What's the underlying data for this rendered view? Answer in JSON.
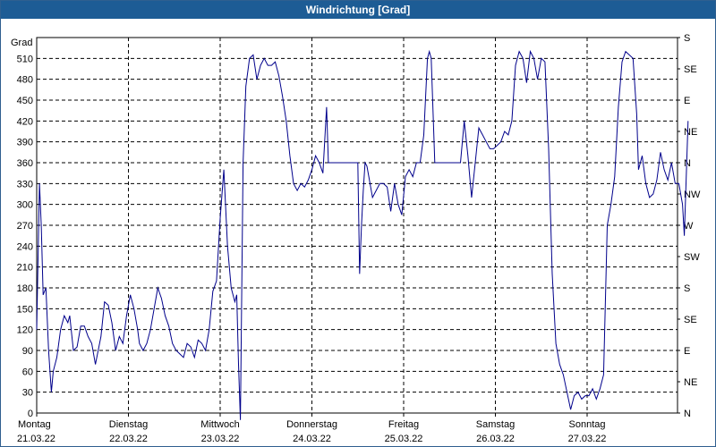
{
  "window": {
    "title": "Windrichtung [Grad]"
  },
  "chart_data": {
    "type": "line",
    "title": "Windrichtung [Grad]",
    "ylabel": "Grad",
    "ylim": [
      0,
      540
    ],
    "y_ticks": [
      0,
      30,
      60,
      90,
      120,
      150,
      180,
      210,
      240,
      270,
      300,
      330,
      360,
      390,
      420,
      450,
      480,
      510
    ],
    "right_ticks": [
      {
        "value": 0,
        "label": "N"
      },
      {
        "value": 45,
        "label": "NE"
      },
      {
        "value": 90,
        "label": "E"
      },
      {
        "value": 135,
        "label": "SE"
      },
      {
        "value": 180,
        "label": "S"
      },
      {
        "value": 225,
        "label": "SW"
      },
      {
        "value": 270,
        "label": "W"
      },
      {
        "value": 315,
        "label": "NW"
      },
      {
        "value": 360,
        "label": "N"
      },
      {
        "value": 405,
        "label": "NE"
      },
      {
        "value": 450,
        "label": "E"
      },
      {
        "value": 495,
        "label": "SE"
      },
      {
        "value": 540,
        "label": "S"
      }
    ],
    "xlim": [
      0,
      7
    ],
    "x_ticks": [
      {
        "day": "Montag",
        "date": "21.03.22"
      },
      {
        "day": "Dienstag",
        "date": "22.03.22"
      },
      {
        "day": "Mittwoch",
        "date": "23.03.22"
      },
      {
        "day": "Donnerstag",
        "date": "24.03.22"
      },
      {
        "day": "Freitag",
        "date": "25.03.22"
      },
      {
        "day": "Samstag",
        "date": "26.03.22"
      },
      {
        "day": "Sonntag",
        "date": "27.03.22"
      }
    ],
    "grid": true,
    "series": [
      {
        "color": "#00008b",
        "points": [
          [
            0.0,
            120
          ],
          [
            0.03,
            330
          ],
          [
            0.05,
            270
          ],
          [
            0.07,
            170
          ],
          [
            0.1,
            180
          ],
          [
            0.13,
            90
          ],
          [
            0.16,
            30
          ],
          [
            0.18,
            60
          ],
          [
            0.22,
            80
          ],
          [
            0.26,
            120
          ],
          [
            0.3,
            140
          ],
          [
            0.34,
            130
          ],
          [
            0.36,
            140
          ],
          [
            0.4,
            90
          ],
          [
            0.44,
            95
          ],
          [
            0.48,
            125
          ],
          [
            0.52,
            125
          ],
          [
            0.56,
            110
          ],
          [
            0.6,
            100
          ],
          [
            0.64,
            70
          ],
          [
            0.7,
            110
          ],
          [
            0.74,
            160
          ],
          [
            0.78,
            155
          ],
          [
            0.82,
            130
          ],
          [
            0.86,
            90
          ],
          [
            0.9,
            110
          ],
          [
            0.94,
            100
          ],
          [
            0.98,
            140
          ],
          [
            1.02,
            170
          ],
          [
            1.06,
            150
          ],
          [
            1.1,
            120
          ],
          [
            1.12,
            100
          ],
          [
            1.16,
            90
          ],
          [
            1.2,
            100
          ],
          [
            1.24,
            120
          ],
          [
            1.28,
            150
          ],
          [
            1.32,
            180
          ],
          [
            1.36,
            165
          ],
          [
            1.4,
            140
          ],
          [
            1.44,
            125
          ],
          [
            1.48,
            100
          ],
          [
            1.52,
            90
          ],
          [
            1.56,
            85
          ],
          [
            1.6,
            80
          ],
          [
            1.64,
            100
          ],
          [
            1.68,
            95
          ],
          [
            1.72,
            80
          ],
          [
            1.76,
            105
          ],
          [
            1.8,
            100
          ],
          [
            1.84,
            90
          ],
          [
            1.88,
            120
          ],
          [
            1.92,
            175
          ],
          [
            1.96,
            190
          ],
          [
            2.0,
            280
          ],
          [
            2.04,
            350
          ],
          [
            2.08,
            240
          ],
          [
            2.12,
            180
          ],
          [
            2.16,
            160
          ],
          [
            2.18,
            170
          ],
          [
            2.2,
            70
          ],
          [
            2.22,
            -10
          ],
          [
            2.25,
            360
          ],
          [
            2.28,
            470
          ],
          [
            2.32,
            510
          ],
          [
            2.36,
            515
          ],
          [
            2.4,
            480
          ],
          [
            2.44,
            500
          ],
          [
            2.48,
            510
          ],
          [
            2.52,
            500
          ],
          [
            2.56,
            500
          ],
          [
            2.6,
            505
          ],
          [
            2.64,
            485
          ],
          [
            2.68,
            455
          ],
          [
            2.72,
            420
          ],
          [
            2.76,
            370
          ],
          [
            2.8,
            330
          ],
          [
            2.84,
            320
          ],
          [
            2.88,
            330
          ],
          [
            2.92,
            325
          ],
          [
            2.96,
            335
          ],
          [
            3.0,
            350
          ],
          [
            3.04,
            370
          ],
          [
            3.08,
            360
          ],
          [
            3.12,
            345
          ],
          [
            3.16,
            440
          ],
          [
            3.18,
            360
          ],
          [
            3.22,
            360
          ],
          [
            3.26,
            360
          ],
          [
            3.3,
            360
          ],
          [
            3.34,
            360
          ],
          [
            3.38,
            360
          ],
          [
            3.42,
            360
          ],
          [
            3.46,
            360
          ],
          [
            3.5,
            360
          ],
          [
            3.52,
            200
          ],
          [
            3.54,
            270
          ],
          [
            3.56,
            320
          ],
          [
            3.58,
            360
          ],
          [
            3.6,
            355
          ],
          [
            3.62,
            340
          ],
          [
            3.66,
            310
          ],
          [
            3.7,
            320
          ],
          [
            3.74,
            330
          ],
          [
            3.78,
            330
          ],
          [
            3.82,
            325
          ],
          [
            3.86,
            290
          ],
          [
            3.9,
            330
          ],
          [
            3.94,
            300
          ],
          [
            3.98,
            285
          ],
          [
            4.02,
            340
          ],
          [
            4.06,
            350
          ],
          [
            4.1,
            340
          ],
          [
            4.14,
            360
          ],
          [
            4.18,
            360
          ],
          [
            4.22,
            400
          ],
          [
            4.26,
            510
          ],
          [
            4.28,
            520
          ],
          [
            4.3,
            510
          ],
          [
            4.34,
            360
          ],
          [
            4.38,
            360
          ],
          [
            4.42,
            360
          ],
          [
            4.46,
            360
          ],
          [
            4.5,
            360
          ],
          [
            4.54,
            360
          ],
          [
            4.58,
            360
          ],
          [
            4.62,
            360
          ],
          [
            4.66,
            420
          ],
          [
            4.7,
            370
          ],
          [
            4.74,
            310
          ],
          [
            4.78,
            360
          ],
          [
            4.82,
            410
          ],
          [
            4.86,
            400
          ],
          [
            4.9,
            390
          ],
          [
            4.94,
            380
          ],
          [
            4.98,
            380
          ],
          [
            5.02,
            385
          ],
          [
            5.06,
            390
          ],
          [
            5.1,
            405
          ],
          [
            5.14,
            400
          ],
          [
            5.18,
            420
          ],
          [
            5.22,
            500
          ],
          [
            5.26,
            520
          ],
          [
            5.3,
            510
          ],
          [
            5.34,
            475
          ],
          [
            5.38,
            520
          ],
          [
            5.42,
            510
          ],
          [
            5.46,
            480
          ],
          [
            5.5,
            510
          ],
          [
            5.54,
            505
          ],
          [
            5.58,
            380
          ],
          [
            5.62,
            200
          ],
          [
            5.66,
            100
          ],
          [
            5.7,
            70
          ],
          [
            5.74,
            55
          ],
          [
            5.78,
            30
          ],
          [
            5.82,
            5
          ],
          [
            5.86,
            25
          ],
          [
            5.9,
            30
          ],
          [
            5.94,
            20
          ],
          [
            5.98,
            25
          ],
          [
            6.02,
            25
          ],
          [
            6.06,
            35
          ],
          [
            6.1,
            20
          ],
          [
            6.14,
            35
          ],
          [
            6.18,
            55
          ],
          [
            6.22,
            270
          ],
          [
            6.26,
            300
          ],
          [
            6.3,
            340
          ],
          [
            6.34,
            440
          ],
          [
            6.38,
            505
          ],
          [
            6.42,
            520
          ],
          [
            6.46,
            515
          ],
          [
            6.5,
            510
          ],
          [
            6.54,
            430
          ],
          [
            6.56,
            350
          ],
          [
            6.6,
            370
          ],
          [
            6.64,
            330
          ],
          [
            6.68,
            310
          ],
          [
            6.72,
            315
          ],
          [
            6.76,
            335
          ],
          [
            6.8,
            375
          ],
          [
            6.84,
            350
          ],
          [
            6.88,
            335
          ],
          [
            6.92,
            360
          ],
          [
            6.96,
            330
          ],
          [
            7.0,
            330
          ],
          [
            7.04,
            300
          ],
          [
            7.06,
            255
          ],
          [
            7.1,
            420
          ]
        ]
      }
    ]
  }
}
